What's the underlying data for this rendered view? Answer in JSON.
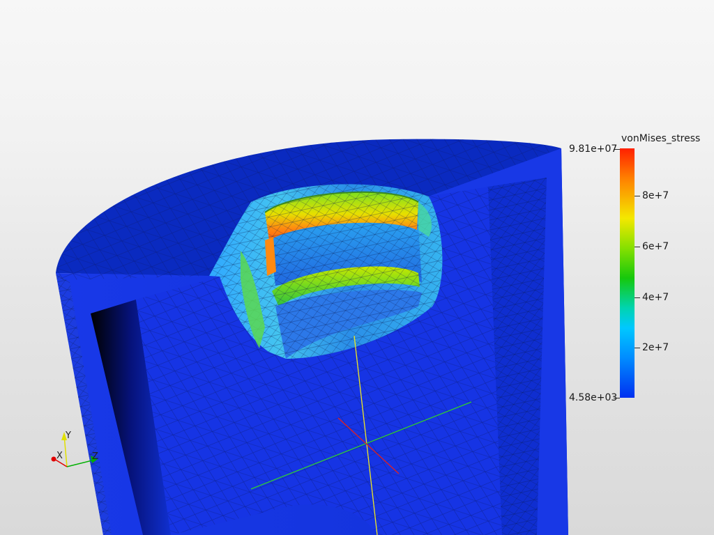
{
  "viewer": {
    "scalar_field": "vonMises_stress",
    "colormap": [
      "#ff2000",
      "#ff8000",
      "#f4e800",
      "#86e000",
      "#16c80c",
      "#00d4b0",
      "#00c8ff",
      "#008cff",
      "#0030f0"
    ],
    "background_color": "#efefef",
    "mesh_base_color": "#1030e0"
  },
  "legend": {
    "title": "vonMises_stress",
    "max_label": "9.81e+07",
    "min_label": "4.58e+03",
    "tick_labels": [
      "8e+7",
      "6e+7",
      "4e+7",
      "2e+7"
    ]
  },
  "axes_triad": {
    "x_label": "X",
    "y_label": "Y",
    "z_label": "Z",
    "x_color": "#e00000",
    "y_color": "#e0e000",
    "z_color": "#00b000"
  }
}
